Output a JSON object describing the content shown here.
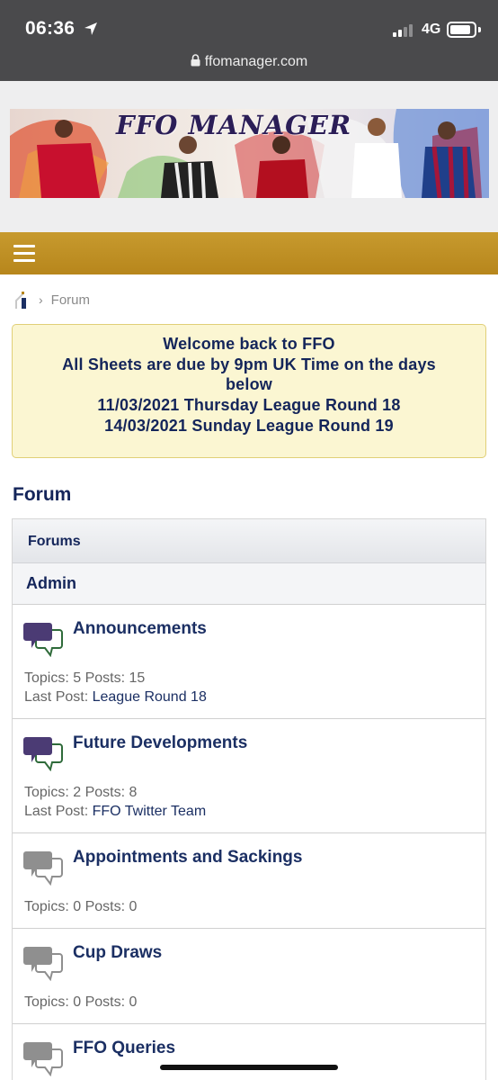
{
  "status_bar": {
    "time": "06:36",
    "network": "4G",
    "url": "ffomanager.com"
  },
  "banner": {
    "title": "FFO MANAGER"
  },
  "breadcrumb": {
    "current": "Forum"
  },
  "notice": {
    "lines": [
      "Welcome back to FFO",
      "All Sheets are due by 9pm UK Time on the days",
      "below",
      "11/03/2021 Thursday League Round 18",
      "14/03/2021 Sunday League Round 19"
    ]
  },
  "page_title": "Forum",
  "forums_header": "Forums",
  "category": "Admin",
  "forums": [
    {
      "title": "Announcements",
      "stats": "Topics: 5 Posts: 15",
      "last_post_label": "Last Post:",
      "last_post": "League Round 18",
      "icon": "speech-bubble-purple-icon"
    },
    {
      "title": "Future Developments",
      "stats": "Topics: 2 Posts: 8",
      "last_post_label": "Last Post:",
      "last_post": "FFO Twitter Team",
      "icon": "speech-bubble-purple-icon"
    },
    {
      "title": "Appointments and Sackings",
      "stats": "Topics: 0 Posts: 0",
      "icon": "speech-bubble-grey-icon"
    },
    {
      "title": "Cup Draws",
      "stats": "Topics: 0 Posts: 0",
      "icon": "speech-bubble-grey-icon"
    },
    {
      "title": "FFO Queries",
      "icon": "speech-bubble-grey-icon"
    }
  ],
  "colors": {
    "accent_bar": "#b7861c",
    "link": "#1b2f63",
    "notice_bg": "#fbf6d2",
    "status_bar": "#4a4a4c"
  }
}
